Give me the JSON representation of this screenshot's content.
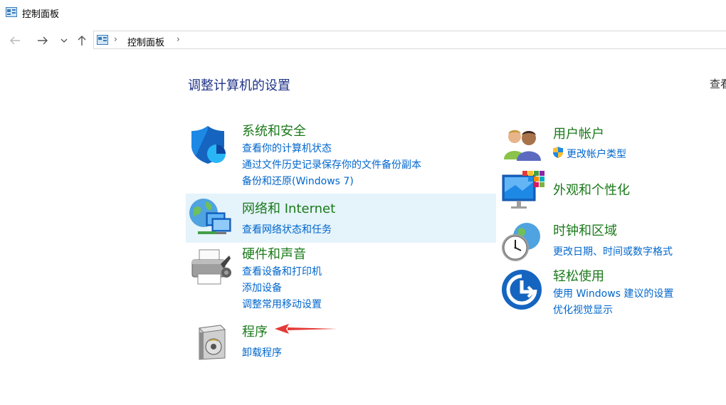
{
  "window": {
    "title": "控制面板"
  },
  "address": {
    "crumb": "控制面板",
    "separator": "›"
  },
  "main": {
    "heading": "调整计算机的设置",
    "view_by": "查看"
  },
  "categories_left": [
    {
      "title": "系统和安全",
      "links": [
        "查看你的计算机状态",
        "通过文件历史记录保存你的文件备份副本",
        "备份和还原(Windows 7)"
      ]
    },
    {
      "title": "网络和 Internet",
      "links": [
        "查看网络状态和任务"
      ]
    },
    {
      "title": "硬件和声音",
      "links": [
        "查看设备和打印机",
        "添加设备",
        "调整常用移动设置"
      ]
    },
    {
      "title": "程序",
      "links": [
        "卸载程序"
      ]
    }
  ],
  "categories_right": [
    {
      "title": "用户帐户",
      "links": [
        "更改帐户类型"
      ]
    },
    {
      "title": "外观和个性化",
      "links": []
    },
    {
      "title": "时钟和区域",
      "links": [
        "更改日期、时间或数字格式"
      ]
    },
    {
      "title": "轻松使用",
      "links": [
        "使用 Windows 建议的设置",
        "优化视觉显示"
      ]
    }
  ],
  "colors": {
    "category_title": "#1a7a1a",
    "link": "#0066cc",
    "heading": "#1e3287",
    "highlight": "#e5f3fb",
    "annotation_arrow": "#e53935"
  }
}
